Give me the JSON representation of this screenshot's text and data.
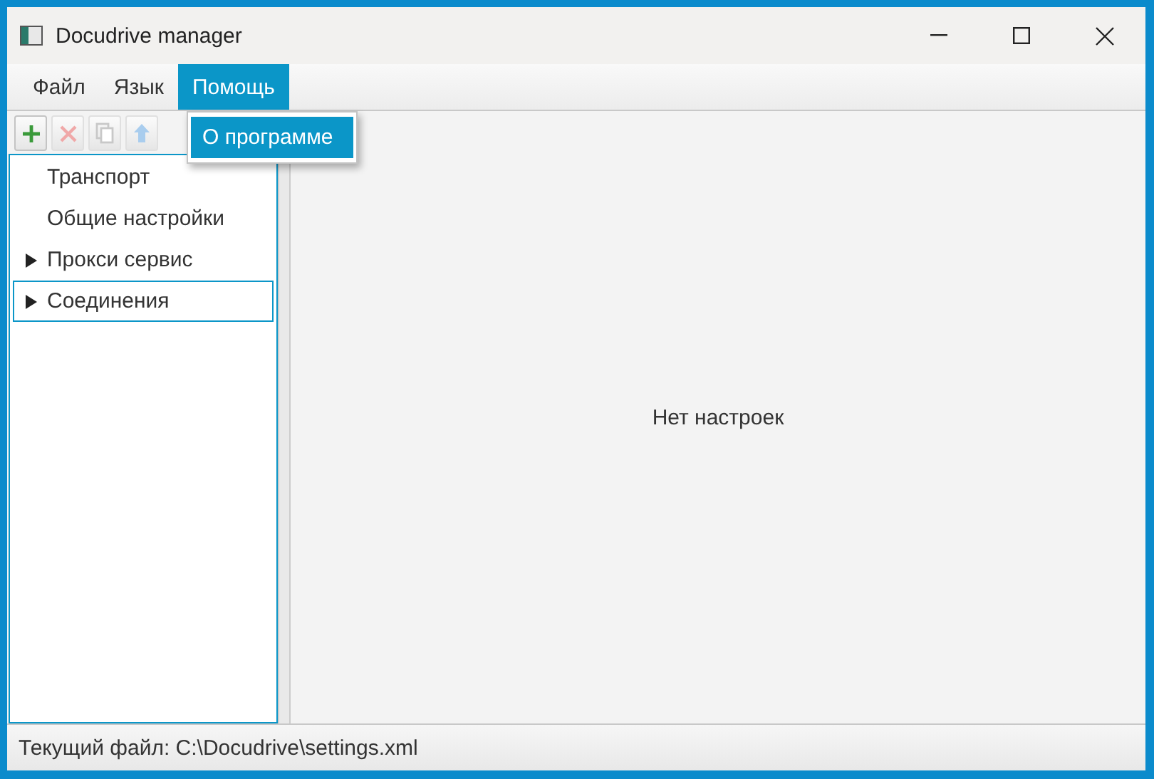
{
  "window": {
    "title": "Docudrive manager"
  },
  "menu": [
    {
      "label": "Файл",
      "selected": false
    },
    {
      "label": "Язык",
      "selected": false
    },
    {
      "label": "Помощь",
      "selected": true
    }
  ],
  "dropdown": [
    {
      "label": "О программе",
      "selected": true
    }
  ],
  "toolbar": [
    {
      "kind": "add",
      "disabled": false
    },
    {
      "kind": "delete",
      "disabled": true
    },
    {
      "kind": "copy",
      "disabled": true
    },
    {
      "kind": "up",
      "disabled": true
    }
  ],
  "tree": [
    {
      "label": "Транспорт",
      "selected": false
    },
    {
      "label": "Общие настройки",
      "selected": false
    },
    {
      "label": "Прокси сервис",
      "selected": false,
      "expanded": false
    },
    {
      "label": "Соединения",
      "selected": true,
      "expanded": false
    }
  ],
  "content": {
    "message": "Нет настроек"
  },
  "status_bar": "Текущий файл: C:\\Docudrive\\settings.xml"
}
